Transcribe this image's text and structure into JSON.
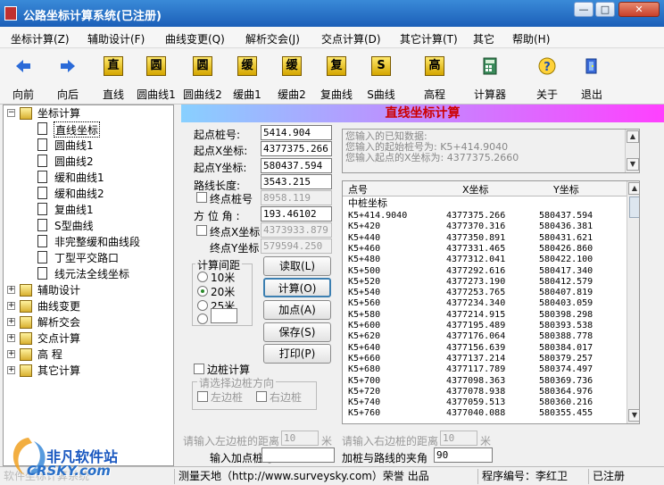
{
  "window": {
    "title": "公路坐标计算系统(已注册)",
    "min": "—",
    "max": "□",
    "close": "✕"
  },
  "menu": [
    "坐标计算(Z)",
    "辅助设计(F)",
    "曲线变更(Q)",
    "解析交会(J)",
    "交点计算(D)",
    "其它计算(T)",
    "其它",
    "帮助(H)"
  ],
  "toolbar": [
    "向前",
    "向后",
    "直线",
    "圆曲线1",
    "圆曲线2",
    "缓曲1",
    "缓曲2",
    "复曲线",
    "S曲线",
    "高程",
    "计算器",
    "关于",
    "退出"
  ],
  "toolbar_glyphs": {
    "zhi": "直",
    "yuan1": "圆",
    "yuan2": "圆",
    "huan1": "缓",
    "huan2": "缓",
    "fu": "复",
    "s": "S",
    "gao": "高"
  },
  "tree": {
    "root": "坐标计算",
    "children": [
      "直线坐标",
      "圆曲线1",
      "圆曲线2",
      "缓和曲线1",
      "缓和曲线2",
      "复曲线1",
      "S型曲线",
      "非完整缓和曲线段",
      "丁型平交路口",
      "线元法全线坐标"
    ],
    "others": [
      "辅助设计",
      "曲线变更",
      "解析交会",
      "交点计算",
      "高  程",
      "其它计算"
    ]
  },
  "panel": {
    "banner": "直线坐标计算",
    "start_station_label": "起点桩号:",
    "start_station": "5414.904",
    "start_x_label": "起点X坐标:",
    "start_x": "4377375.266",
    "start_y_label": "起点Y坐标:",
    "start_y": "580437.594",
    "length_label": "路线长度:",
    "length": "3543.215",
    "end_station_label": "终点桩号",
    "end_station": "8958.119",
    "azimuth_label": "方 位 角 :",
    "azimuth": "193.46102",
    "end_x_label": "终点X坐标",
    "end_x": "4373933.879",
    "end_y_label": "终点Y坐标",
    "end_y": "579594.250",
    "interval_title": "计算间距",
    "intervals": [
      "10米",
      "20米",
      "25米"
    ],
    "interval_selected": "20米",
    "buttons": {
      "read": "读取(L)",
      "calc": "计算(O)",
      "add": "加点(A)",
      "save": "保存(S)",
      "print": "打印(P)"
    },
    "edge_calc_label": "边桩计算",
    "edge_dir_title": "请选择边桩方向",
    "left_edge": "左边桩",
    "right_edge": "右边桩",
    "left_dist_label": "请输入左边桩的距离",
    "left_dist": "10",
    "left_unit": "米",
    "right_dist_label": "请输入右边桩的距离",
    "right_dist": "10",
    "right_unit": "米",
    "add_station_label": "输入加点桩号",
    "add_station": "",
    "angle_label": "加桩与路线的夹角",
    "angle": "90",
    "messages": [
      "您输入的已知数据:",
      "您输入的起始桩号为: K5+414.9040",
      "您输入起点的X坐标为: 4377375.2660"
    ]
  },
  "table": {
    "headers": [
      "点号",
      "X坐标",
      "Y坐标"
    ],
    "section": "中桩坐标",
    "rows": [
      [
        "K5+414.9040",
        "4377375.266",
        "580437.594"
      ],
      [
        "K5+420",
        "4377370.316",
        "580436.381"
      ],
      [
        "K5+440",
        "4377350.891",
        "580431.621"
      ],
      [
        "K5+460",
        "4377331.465",
        "580426.860"
      ],
      [
        "K5+480",
        "4377312.041",
        "580422.100"
      ],
      [
        "K5+500",
        "4377292.616",
        "580417.340"
      ],
      [
        "K5+520",
        "4377273.190",
        "580412.579"
      ],
      [
        "K5+540",
        "4377253.765",
        "580407.819"
      ],
      [
        "K5+560",
        "4377234.340",
        "580403.059"
      ],
      [
        "K5+580",
        "4377214.915",
        "580398.298"
      ],
      [
        "K5+600",
        "4377195.489",
        "580393.538"
      ],
      [
        "K5+620",
        "4377176.064",
        "580388.778"
      ],
      [
        "K5+640",
        "4377156.639",
        "580384.017"
      ],
      [
        "K5+660",
        "4377137.214",
        "580379.257"
      ],
      [
        "K5+680",
        "4377117.789",
        "580374.497"
      ],
      [
        "K5+700",
        "4377098.363",
        "580369.736"
      ],
      [
        "K5+720",
        "4377078.938",
        "580364.976"
      ],
      [
        "K5+740",
        "4377059.513",
        "580360.216"
      ],
      [
        "K5+760",
        "4377040.088",
        "580355.455"
      ]
    ]
  },
  "status": {
    "left": "软件坐标计算系统",
    "center": "测量天地（http://www.surveysky.com）荣誉 出品",
    "program": "程序编号：李红卫",
    "reg": "已注册"
  },
  "watermark": {
    "line1": "非凡软件站",
    "line2": "CRSKY.com"
  },
  "colors": {
    "title": "#1b5fb8",
    "banner_text": "#c00000",
    "radio_dot": "#2a8a2a"
  }
}
